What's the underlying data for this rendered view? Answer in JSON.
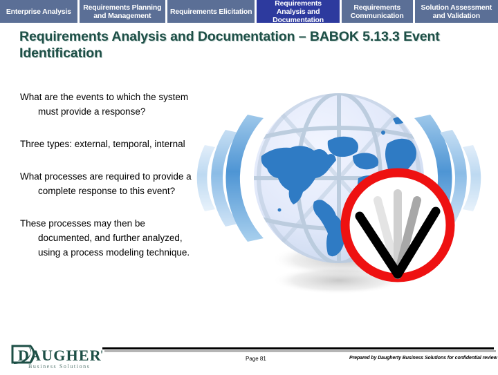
{
  "tabbar": {
    "tabs": [
      {
        "label": "Enterprise Analysis",
        "active": false
      },
      {
        "label": "Requirements Planning and Management",
        "active": false
      },
      {
        "label": "Requirements Elicitation",
        "active": false
      },
      {
        "label": "Requirements Analysis and Documentation",
        "active": true
      },
      {
        "label": "Requirements Communication",
        "active": false
      },
      {
        "label": "Solution Assessment and Validation",
        "active": false
      }
    ],
    "inactive_color": "#5b6f96",
    "active_color": "#2d3a9e",
    "text_color": "#ffffff"
  },
  "slide": {
    "title": "Requirements Analysis and Documentation – BABOK 5.13.3 Event Identification",
    "title_color": "#1d4f46",
    "bullets": [
      "What are the events to which the system must provide a response?",
      "Three types: external, temporal, internal",
      "What processes are required to provide a complete response to this event?",
      "These processes may then be documented, and further analyzed, using a process modeling technique."
    ]
  },
  "graphic": {
    "name": "globe-with-signal-waves-and-clock",
    "globe_fill": "#e3e9fa",
    "globe_grid": "#b9cada",
    "continent_fill": "#2f7bc4",
    "wave_colors": [
      "#5f9fd8",
      "#8fbde6",
      "#c3dbf2"
    ],
    "clock_rim_color": "#ee1111",
    "clock_face_color": "#ffffff",
    "clock_hand_color": "#000000",
    "clock_trail_colors": [
      "#d9d9d9",
      "#ededed",
      "#a8a8a8"
    ]
  },
  "footer": {
    "logo_name": "Daugherty",
    "logo_tagline": "Business Solutions",
    "logo_color": "#1d4f46",
    "page_label": "Page 81",
    "confidential_notice": "Prepared by Daugherty Business Solutions for confidential review"
  }
}
